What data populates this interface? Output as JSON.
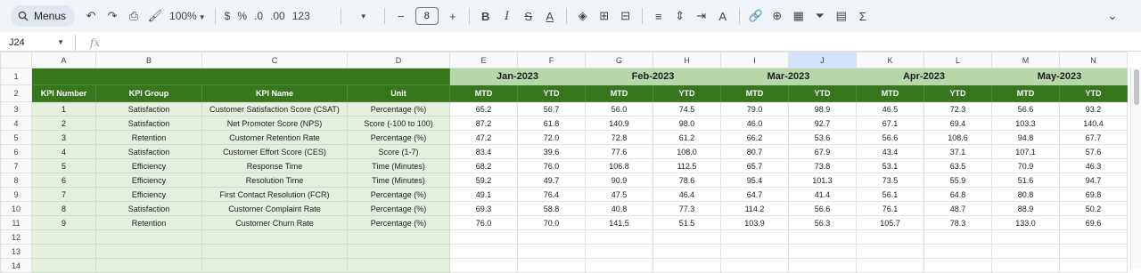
{
  "toolbar": {
    "menus_label": "Menus",
    "zoom": "100%",
    "currency": "$",
    "percent": "%",
    "dec_decrease": ".0",
    "dec_increase": ".00",
    "number_format": "123",
    "font_size": "8",
    "sigma": "Σ"
  },
  "formula_bar": {
    "cell_ref": "J24",
    "fx": "fx",
    "value": ""
  },
  "columns": [
    "A",
    "B",
    "C",
    "D",
    "E",
    "F",
    "G",
    "H",
    "I",
    "J",
    "K",
    "L",
    "M",
    "N"
  ],
  "selected_column": "J",
  "rows": [
    "1",
    "2",
    "3",
    "4",
    "5",
    "6",
    "7",
    "8",
    "9",
    "10",
    "11",
    "12",
    "13",
    "14"
  ],
  "header": {
    "kpi_number": "KPI Number",
    "kpi_group": "KPI Group",
    "kpi_name": "KPI Name",
    "unit": "Unit",
    "months": [
      "Jan-2023",
      "Feb-2023",
      "Mar-2023",
      "Apr-2023",
      "May-2023"
    ],
    "mtd": "MTD",
    "ytd": "YTD"
  },
  "kpis": [
    {
      "num": "1",
      "group": "Satisfaction",
      "name": "Customer Satisfaction Score (CSAT)",
      "unit": "Percentage (%)",
      "values": [
        "65.2",
        "56.7",
        "56.0",
        "74.5",
        "79.0",
        "98.9",
        "46.5",
        "72.3",
        "56.6",
        "93.2"
      ]
    },
    {
      "num": "2",
      "group": "Satisfaction",
      "name": "Net Promoter Score (NPS)",
      "unit": "Score (-100 to 100)",
      "values": [
        "87.2",
        "61.8",
        "140.9",
        "98.0",
        "46.0",
        "92.7",
        "67.1",
        "69.4",
        "103.3",
        "140.4"
      ]
    },
    {
      "num": "3",
      "group": "Retention",
      "name": "Customer Retention Rate",
      "unit": "Percentage (%)",
      "values": [
        "47.2",
        "72.0",
        "72.8",
        "61.2",
        "66.2",
        "53.6",
        "56.6",
        "108.6",
        "94.8",
        "67.7"
      ]
    },
    {
      "num": "4",
      "group": "Satisfaction",
      "name": "Customer Effort Score (CES)",
      "unit": "Score (1-7)",
      "values": [
        "83.4",
        "39.6",
        "77.6",
        "108.0",
        "80.7",
        "67.9",
        "43.4",
        "37.1",
        "107.1",
        "57.6"
      ]
    },
    {
      "num": "5",
      "group": "Efficiency",
      "name": "Response Time",
      "unit": "Time (Minutes)",
      "values": [
        "68.2",
        "76.0",
        "106.8",
        "112.5",
        "65.7",
        "73.8",
        "53.1",
        "63.5",
        "70.9",
        "46.3"
      ]
    },
    {
      "num": "6",
      "group": "Efficiency",
      "name": "Resolution Time",
      "unit": "Time (Minutes)",
      "values": [
        "59.2",
        "49.7",
        "90.9",
        "78.6",
        "95.4",
        "101.3",
        "73.5",
        "55.9",
        "51.6",
        "94.7"
      ]
    },
    {
      "num": "7",
      "group": "Efficiency",
      "name": "First Contact Resolution (FCR)",
      "unit": "Percentage (%)",
      "values": [
        "49.1",
        "76.4",
        "47.5",
        "46.4",
        "64.7",
        "41.4",
        "56.1",
        "64.8",
        "80.8",
        "69.8"
      ]
    },
    {
      "num": "8",
      "group": "Satisfaction",
      "name": "Customer Complaint Rate",
      "unit": "Percentage (%)",
      "values": [
        "69.3",
        "58.8",
        "40.8",
        "77.3",
        "114.2",
        "56.6",
        "76.1",
        "48.7",
        "88.9",
        "50.2"
      ]
    },
    {
      "num": "9",
      "group": "Retention",
      "name": "Customer Churn Rate",
      "unit": "Percentage (%)",
      "values": [
        "76.0",
        "70.0",
        "141.5",
        "51.5",
        "103.9",
        "56.3",
        "105.7",
        "78.3",
        "133.0",
        "69.6"
      ]
    }
  ]
}
